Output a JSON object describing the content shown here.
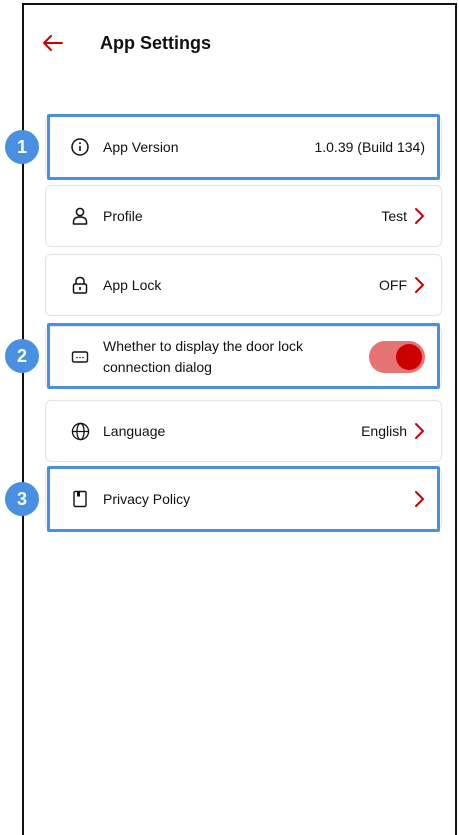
{
  "header": {
    "title": "App Settings"
  },
  "rows": {
    "version": {
      "label": "App Version",
      "value": "1.0.39 (Build 134)"
    },
    "profile": {
      "label": "Profile",
      "value": "Test"
    },
    "applock": {
      "label": "App Lock",
      "value": "OFF"
    },
    "dialog": {
      "label": "Whether to display the door lock connection dialog",
      "toggle_on": true
    },
    "language": {
      "label": "Language",
      "value": "English"
    },
    "privacy": {
      "label": "Privacy Policy"
    }
  },
  "badges": [
    "1",
    "2",
    "3"
  ],
  "colors": {
    "accent": "#cc0000",
    "toggle_track": "#e57373",
    "highlight": "#4a90e2"
  }
}
